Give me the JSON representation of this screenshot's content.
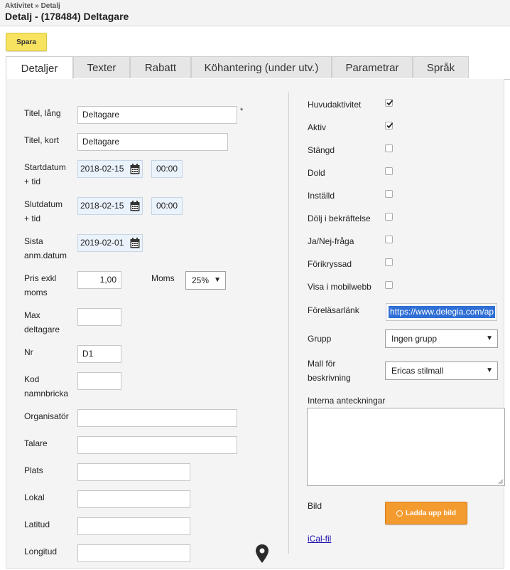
{
  "header": {
    "breadcrumb": "Aktivitet » Detalj",
    "title": "Detalj - (178484) Deltagare"
  },
  "toolbar": {
    "save_label": "Spara"
  },
  "tabs": [
    {
      "label": "Detaljer",
      "active": true
    },
    {
      "label": "Texter"
    },
    {
      "label": "Rabatt"
    },
    {
      "label": "Köhantering (under utv.)"
    },
    {
      "label": "Parametrar"
    },
    {
      "label": "Språk"
    }
  ],
  "form": {
    "title_long": {
      "label": "Titel, lång",
      "value": "Deltagare",
      "required_mark": "*"
    },
    "title_short": {
      "label": "Titel, kort",
      "value": "Deltagare"
    },
    "start": {
      "label_1": "Startdatum",
      "label_2": "+ tid",
      "date": "2018-02-15",
      "time": "00:00"
    },
    "end": {
      "label_1": "Slutdatum",
      "label_2": "+ tid",
      "date": "2018-02-15",
      "time": "00:00"
    },
    "last_reg": {
      "label_1": "Sista",
      "label_2": "anm.datum",
      "date": "2019-02-01"
    },
    "price": {
      "label_1": "Pris exkl",
      "label_2": "moms",
      "value": "1,00"
    },
    "vat": {
      "label": "Moms",
      "value": "25%"
    },
    "max_participants": {
      "label_1": "Max",
      "label_2": "deltagare",
      "value": ""
    },
    "nr": {
      "label": "Nr",
      "value": "D1"
    },
    "badge_code": {
      "label_1": "Kod",
      "label_2": "namnbricka",
      "value": ""
    },
    "organizer": {
      "label": "Organisatör",
      "value": ""
    },
    "speaker": {
      "label": "Talare",
      "value": ""
    },
    "place": {
      "label": "Plats",
      "value": ""
    },
    "venue": {
      "label": "Lokal",
      "value": ""
    },
    "latitude": {
      "label": "Latitud",
      "value": ""
    },
    "longitude": {
      "label": "Longitud",
      "value": ""
    },
    "map_icon": "map-pin-icon"
  },
  "options": [
    {
      "label": "Huvudaktivitet",
      "checked": true
    },
    {
      "label": "Aktiv",
      "checked": true
    },
    {
      "label": "Stängd",
      "checked": false
    },
    {
      "label": "Dold",
      "checked": false
    },
    {
      "label": "Inställd",
      "checked": false
    },
    {
      "label": "Dölj i bekräftelse",
      "checked": false
    },
    {
      "label": "Ja/Nej-fråga",
      "checked": false
    },
    {
      "label": "Förikryssad",
      "checked": false
    },
    {
      "label": "Visa i mobilwebb",
      "checked": false
    }
  ],
  "right": {
    "lecturer_link": {
      "label": "Föreläsarlänk",
      "value": "https://www.delegia.com/ap"
    },
    "group": {
      "label": "Grupp",
      "value": "Ingen grupp"
    },
    "template": {
      "label_1": "Mall för",
      "label_2": "beskrivning",
      "value": "Ericas stilmall"
    },
    "notes": {
      "label": "Interna anteckningar",
      "value": ""
    },
    "image": {
      "label": "Bild",
      "upload_label": "Ladda upp bild"
    },
    "ical_link": "iCal-fil"
  },
  "colors": {
    "save_button": "#f7e35f",
    "upload_button": "#f49b2f",
    "link_highlight": "#2f6fd6",
    "date_field": "#eaf2fb"
  }
}
